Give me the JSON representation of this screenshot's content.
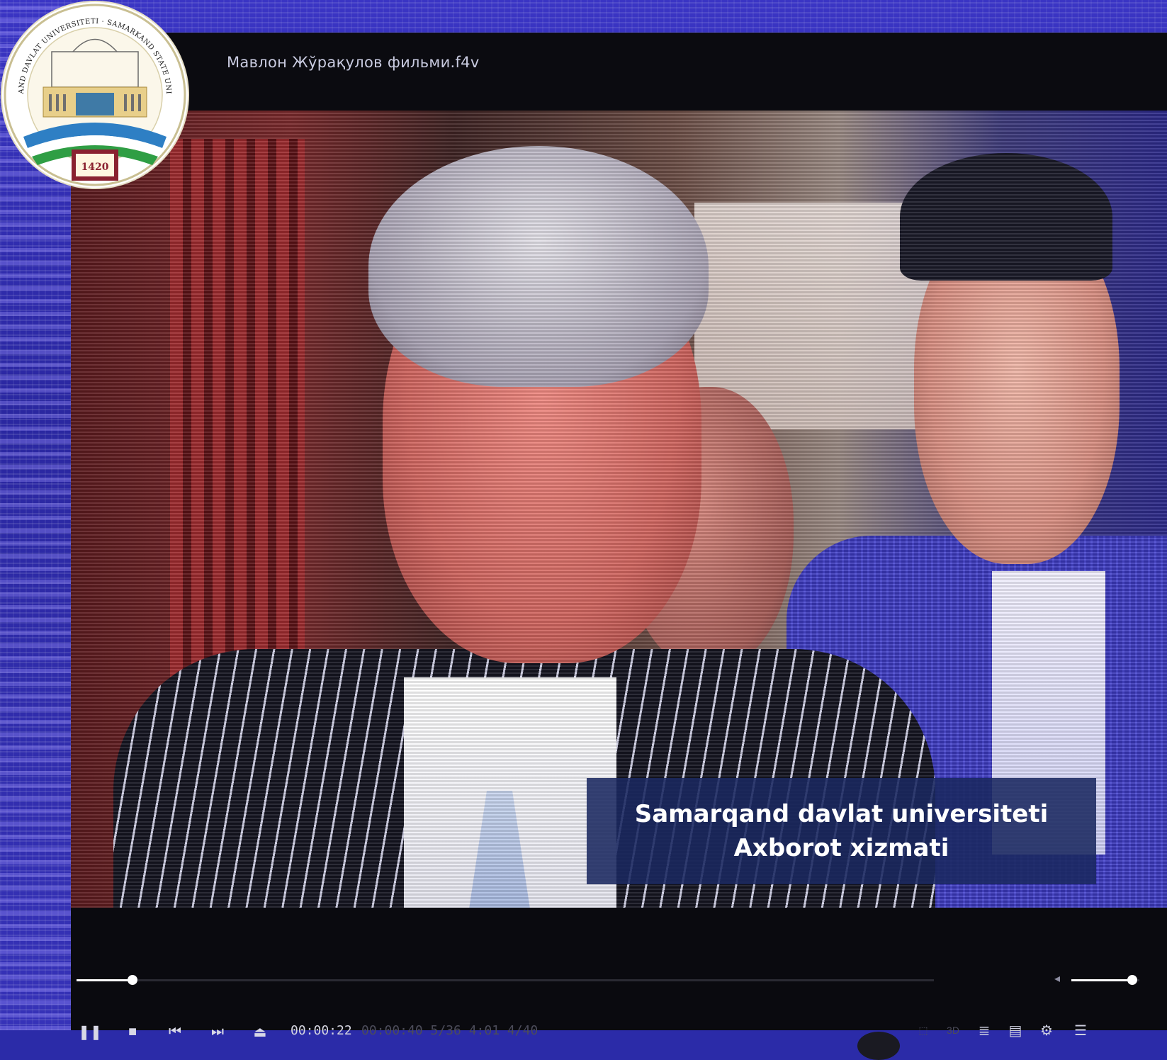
{
  "seal": {
    "text_top": "SAMARQAND DAVLAT UNIVERSITETI · SAMARKAND STATE UNIVERSITY",
    "year": "1420"
  },
  "player": {
    "file_title": "Мавлон Жўрақулов фильми.f4v",
    "seek_progress": 0.065,
    "volume_level": 0.9,
    "current_time": "00:00:22",
    "dim_readout": "00:00:40   5/36   4:01   4/40",
    "controls": {
      "pause_icon": "pause-icon",
      "stop_icon": "stop-icon",
      "prev_icon": "previous-icon",
      "next_icon": "next-icon",
      "eject_icon": "eject-icon"
    },
    "right_controls": {
      "mode_3d_label": "3D",
      "search_icon": "search-list-icon",
      "subtitle_icon": "subtitle-icon",
      "settings_icon": "gear-icon",
      "menu_icon": "menu-icon"
    }
  },
  "watermark": {
    "line1": "Samarqand davlat universiteti",
    "line2": "Axborot xizmati"
  }
}
